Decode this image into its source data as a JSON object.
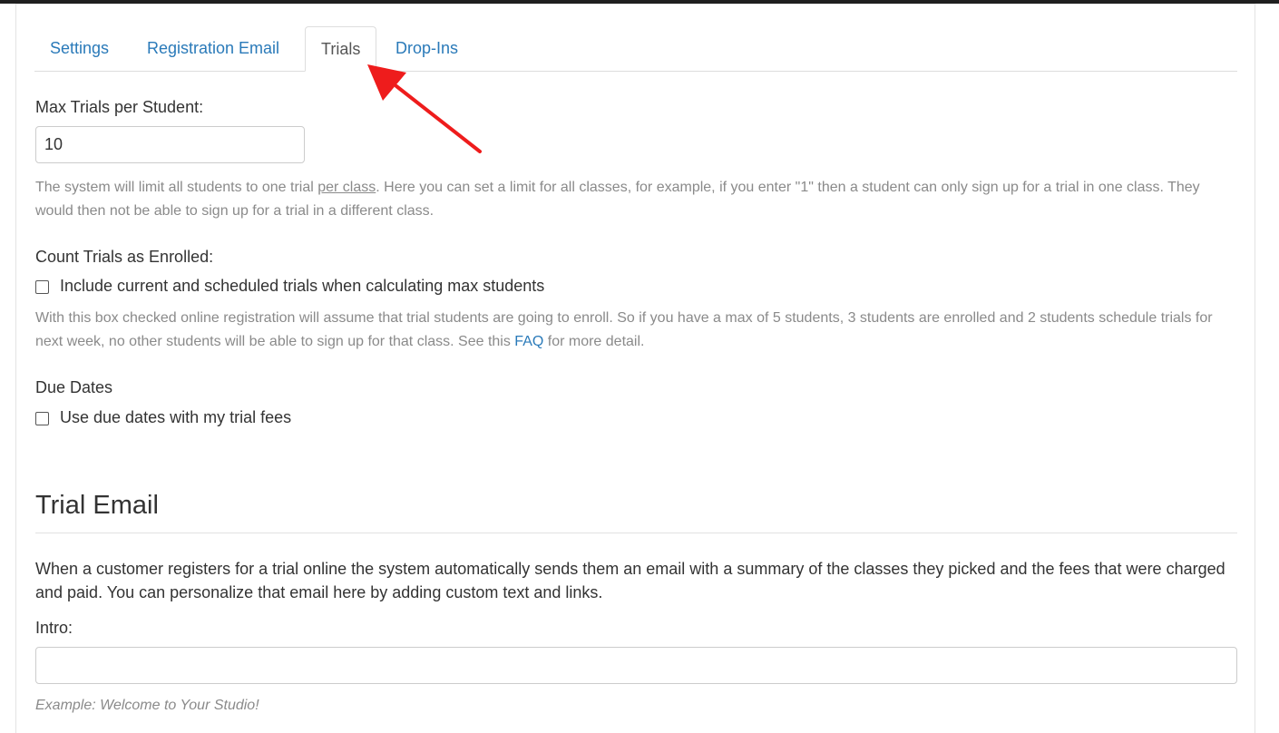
{
  "tabs": [
    {
      "label": "Settings",
      "active": false
    },
    {
      "label": "Registration Email",
      "active": false
    },
    {
      "label": "Trials",
      "active": true
    },
    {
      "label": "Drop-Ins",
      "active": false
    }
  ],
  "max_trials": {
    "label": "Max Trials per Student:",
    "value": "10",
    "help_prefix": "The system will limit all students to one trial ",
    "help_underline": "per class",
    "help_suffix": ". Here you can set a limit for all classes, for example, if you enter \"1\" then a student can only sign up for a trial in one class. They would then not be able to sign up for a trial in a different class."
  },
  "count_trials": {
    "label": "Count Trials as Enrolled:",
    "checkbox_label": "Include current and scheduled trials when calculating max students",
    "checked": false,
    "help_prefix": "With this box checked online registration will assume that trial students are going to enroll. So if you have a max of 5 students, 3 students are enrolled and 2 students schedule trials for next week, no other students will be able to sign up for that class. See this ",
    "help_link": "FAQ",
    "help_suffix": " for more detail."
  },
  "due_dates": {
    "label": "Due Dates",
    "checkbox_label": "Use due dates with my trial fees",
    "checked": false
  },
  "trial_email": {
    "heading": "Trial Email",
    "description": "When a customer registers for a trial online the system automatically sends them an email with a summary of the classes they picked and the fees that were charged and paid. You can personalize that email here by adding custom text and links.",
    "intro_label": "Intro:",
    "intro_value": "",
    "example": "Example: Welcome to Your Studio!"
  },
  "colors": {
    "link": "#2a7ab9",
    "annotation_arrow": "#ee1c1c",
    "help_text": "#8a8a8a"
  }
}
